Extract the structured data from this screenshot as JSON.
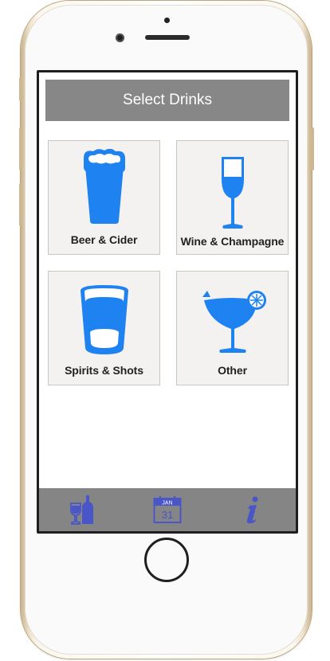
{
  "header": {
    "title": "Select Drinks"
  },
  "drinks": [
    {
      "label": "Beer & Cider"
    },
    {
      "label": "Wine & Champagne"
    },
    {
      "label": "Spirits & Shots"
    },
    {
      "label": "Other"
    }
  ],
  "tabbar": {
    "calendar_month": "JAN",
    "calendar_day": "31"
  },
  "colors": {
    "accent": "#1E82F0",
    "title_bg": "#878787",
    "tab_icon": "#4A55C8"
  }
}
